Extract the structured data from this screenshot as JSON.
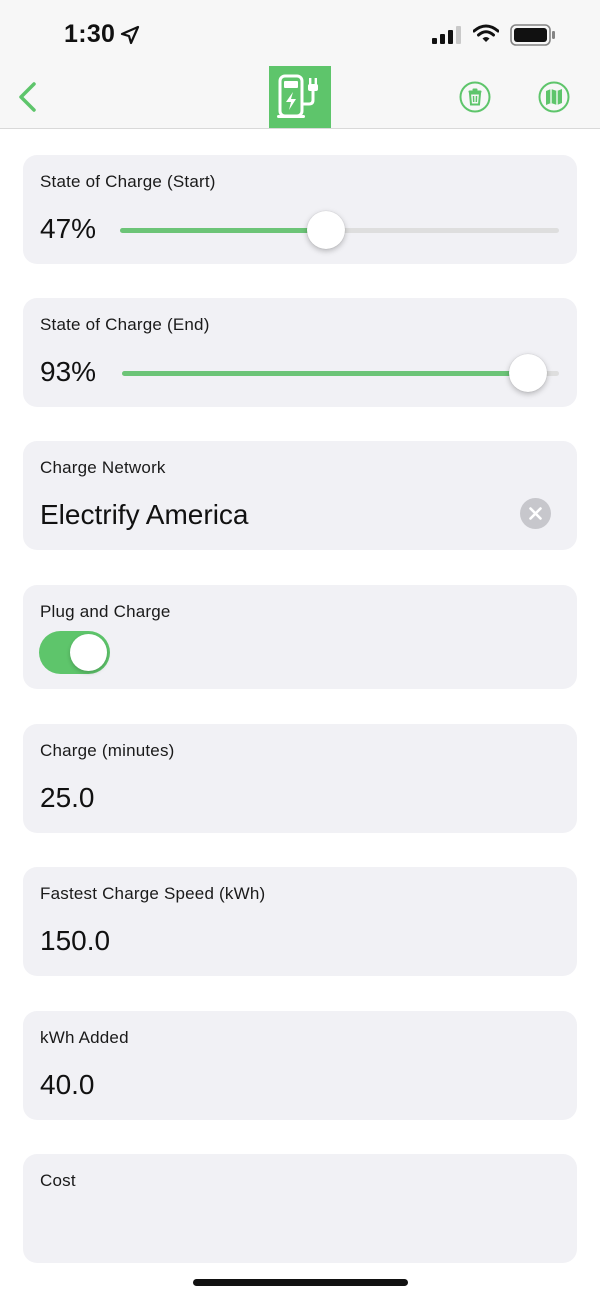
{
  "status_bar": {
    "time": "1:30",
    "icons": [
      "location-arrow-icon",
      "signal-icon",
      "wifi-icon",
      "battery-icon"
    ]
  },
  "nav": {
    "icons": [
      "back-chevron-icon",
      "ev-charger-icon",
      "trash-icon",
      "map-icon"
    ],
    "accent_color": "#5ec56b"
  },
  "fields": {
    "soc_start": {
      "label": "State of Charge (Start)",
      "value_text": "47%",
      "value": 0.47
    },
    "soc_end": {
      "label": "State of Charge (End)",
      "value_text": "93%",
      "value": 0.93
    },
    "network": {
      "label": "Charge Network",
      "value": "Electrify America",
      "clear_icon": "clear-x-icon"
    },
    "plug_and_charge": {
      "label": "Plug and Charge",
      "enabled": true
    },
    "charge_minutes": {
      "label": "Charge (minutes)",
      "value": "25.0"
    },
    "fastest_speed": {
      "label": "Fastest Charge Speed (kWh)",
      "value": "150.0"
    },
    "kwh_added": {
      "label": "kWh Added",
      "value": "40.0"
    },
    "cost": {
      "label": "Cost",
      "value": ""
    }
  },
  "colors": {
    "accent": "#5ec56b",
    "card_bg": "#f1f1f5",
    "track": "#dedede"
  }
}
